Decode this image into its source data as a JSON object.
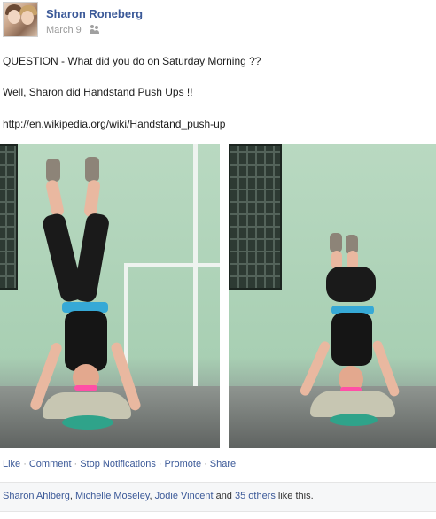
{
  "post": {
    "author": "Sharon Roneberg",
    "date": "March 9",
    "audience_icon": "friends-icon",
    "question": "QUESTION - What did you do on Saturday Morning ??",
    "statement": "Well, Sharon did Handstand Push Ups !!",
    "link": "http://en.wikipedia.org/wiki/Handstand_push-up"
  },
  "actions": {
    "like": "Like",
    "comment": "Comment",
    "stop_notifications": "Stop Notifications",
    "promote": "Promote",
    "share": "Share",
    "separator": "·"
  },
  "likes": {
    "names": [
      "Sharon Ahlberg",
      "Michelle Moseley",
      "Jodie Vincent"
    ],
    "sep": ", ",
    "and": " and ",
    "others": "35 others",
    "suffix": " like this."
  },
  "colors": {
    "link": "#3b5998",
    "meta": "#999999"
  }
}
